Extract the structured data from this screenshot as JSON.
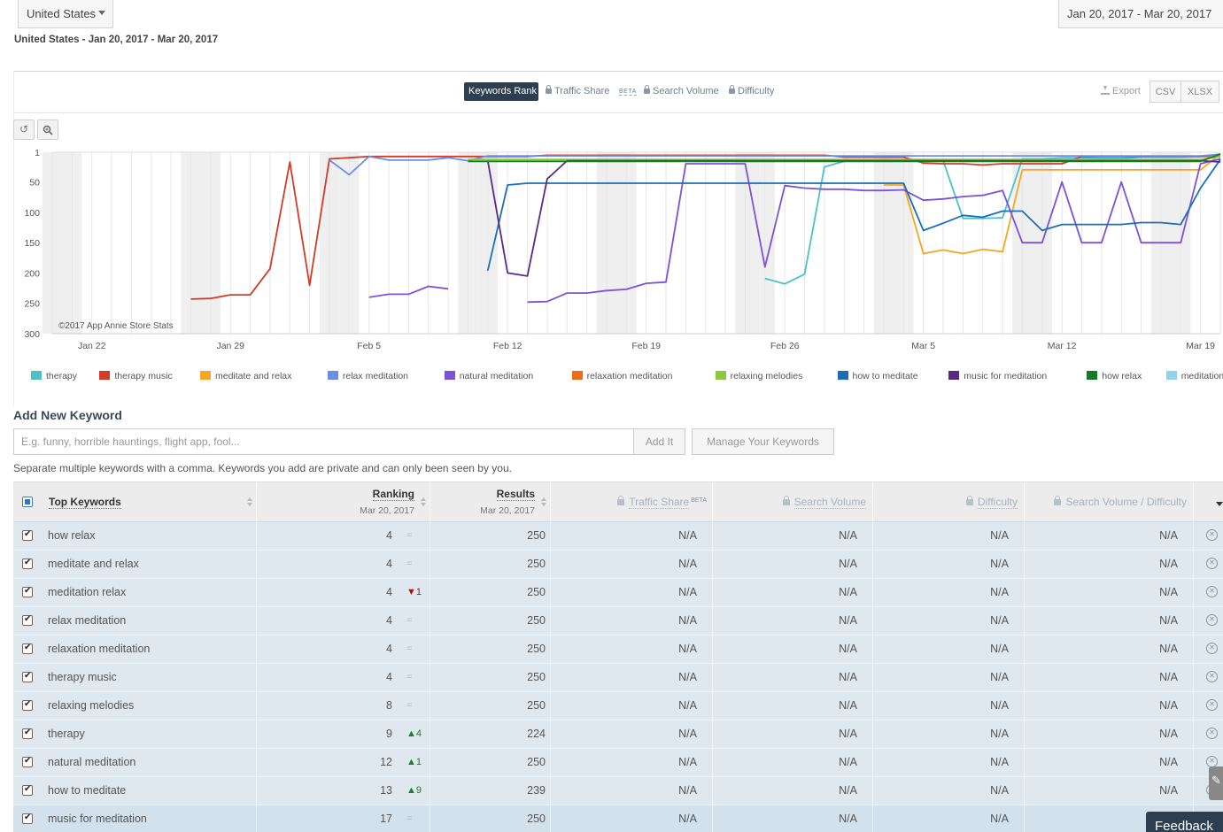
{
  "filters": {
    "country": "United States",
    "date_range": "Jan 20, 2017 - Mar 20, 2017",
    "summary": "United States - Jan 20, 2017 - Mar 20, 2017"
  },
  "tabs": {
    "active": "Keywords Rank",
    "traffic_share": "Traffic Share",
    "beta": "BETA",
    "search_volume": "Search Volume",
    "difficulty": "Difficulty"
  },
  "export": {
    "label": "Export",
    "csv": "CSV",
    "xlsx": "XLSX"
  },
  "zoom_controls": {
    "reset_icon": "undo-icon",
    "zoom_icon": "magnifier-icon"
  },
  "chart_data": {
    "type": "line",
    "credit": "©2017 App Annie Store Stats",
    "y_ticks": [
      "1",
      "50",
      "100",
      "150",
      "200",
      "250",
      "300"
    ],
    "ylim": [
      1,
      300
    ],
    "y_inverted": true,
    "x_ticks": [
      "Jan 22",
      "Jan 29",
      "Feb 5",
      "Feb 12",
      "Feb 19",
      "Feb 26",
      "Mar 5",
      "Mar 12",
      "Mar 19"
    ],
    "x": [
      "Jan 20",
      "Jan 21",
      "Jan 22",
      "Jan 23",
      "Jan 24",
      "Jan 25",
      "Jan 26",
      "Jan 27",
      "Jan 28",
      "Jan 29",
      "Jan 30",
      "Jan 31",
      "Feb 1",
      "Feb 2",
      "Feb 3",
      "Feb 4",
      "Feb 5",
      "Feb 6",
      "Feb 7",
      "Feb 8",
      "Feb 9",
      "Feb 10",
      "Feb 11",
      "Feb 12",
      "Feb 13",
      "Feb 14",
      "Feb 15",
      "Feb 16",
      "Feb 17",
      "Feb 18",
      "Feb 19",
      "Feb 20",
      "Feb 21",
      "Feb 22",
      "Feb 23",
      "Feb 24",
      "Feb 25",
      "Feb 26",
      "Feb 27",
      "Feb 28",
      "Mar 1",
      "Mar 2",
      "Mar 3",
      "Mar 4",
      "Mar 5",
      "Mar 6",
      "Mar 7",
      "Mar 8",
      "Mar 9",
      "Mar 10",
      "Mar 11",
      "Mar 12",
      "Mar 13",
      "Mar 14",
      "Mar 15",
      "Mar 16",
      "Mar 17",
      "Mar 18",
      "Mar 19",
      "Mar 20"
    ],
    "grid": true,
    "series": [
      {
        "name": "therapy",
        "color": "#4dc0c8",
        "values": [
          null,
          null,
          null,
          null,
          null,
          null,
          null,
          null,
          null,
          null,
          null,
          null,
          null,
          null,
          null,
          null,
          null,
          null,
          null,
          null,
          null,
          null,
          null,
          null,
          null,
          null,
          null,
          null,
          null,
          null,
          null,
          null,
          null,
          null,
          null,
          null,
          209,
          218,
          202,
          25,
          16,
          14,
          13,
          14,
          14,
          15,
          110,
          110,
          109,
          12,
          12,
          10,
          10,
          11,
          11,
          9,
          9,
          9,
          8,
          9
        ]
      },
      {
        "name": "therapy music",
        "color": "#d33b27",
        "values": [
          null,
          null,
          null,
          null,
          null,
          null,
          null,
          243,
          242,
          236,
          236,
          193,
          17,
          220,
          12,
          10,
          8,
          8,
          8,
          8,
          8,
          8,
          8,
          8,
          8,
          6,
          6,
          6,
          6,
          6,
          6,
          6,
          6,
          6,
          6,
          6,
          6,
          6,
          6,
          6,
          9,
          9,
          9,
          9,
          19,
          20,
          20,
          22,
          20,
          20,
          20,
          20,
          8,
          8,
          8,
          8,
          8,
          8,
          8,
          4
        ]
      },
      {
        "name": "meditate and relax",
        "color": "#f5a623",
        "values": [
          null,
          null,
          null,
          null,
          null,
          null,
          null,
          null,
          null,
          null,
          null,
          null,
          null,
          null,
          null,
          null,
          null,
          null,
          null,
          null,
          null,
          null,
          null,
          null,
          null,
          null,
          null,
          null,
          null,
          null,
          null,
          null,
          null,
          null,
          null,
          null,
          null,
          null,
          null,
          null,
          null,
          null,
          55,
          55,
          168,
          162,
          168,
          161,
          165,
          30,
          30,
          30,
          30,
          30,
          30,
          30,
          30,
          30,
          30,
          4
        ]
      },
      {
        "name": "relax meditation",
        "color": "#6b8fe8",
        "values": [
          null,
          null,
          null,
          null,
          null,
          null,
          null,
          null,
          null,
          null,
          null,
          null,
          null,
          null,
          14,
          38,
          8,
          14,
          14,
          14,
          10,
          15,
          7,
          7,
          7,
          7,
          7,
          7,
          7,
          7,
          7,
          7,
          7,
          7,
          7,
          7,
          7,
          7,
          7,
          7,
          7,
          7,
          7,
          7,
          7,
          7,
          7,
          7,
          7,
          7,
          7,
          7,
          7,
          7,
          7,
          7,
          7,
          7,
          7,
          4
        ]
      },
      {
        "name": "natural meditation",
        "color": "#7b52d8",
        "values": [
          null,
          null,
          null,
          null,
          null,
          null,
          null,
          null,
          null,
          null,
          null,
          null,
          null,
          null,
          null,
          null,
          240,
          235,
          235,
          222,
          226,
          null,
          null,
          null,
          248,
          247,
          233,
          233,
          229,
          227,
          217,
          215,
          20,
          20,
          20,
          20,
          190,
          56,
          60,
          62,
          62,
          64,
          64,
          63,
          80,
          78,
          74,
          72,
          64,
          150,
          150,
          50,
          150,
          150,
          50,
          150,
          150,
          150,
          20,
          12
        ]
      },
      {
        "name": "relaxation meditation",
        "color": "#ec6c17",
        "values": [
          null,
          null,
          null,
          null,
          null,
          null,
          null,
          null,
          null,
          null,
          null,
          null,
          null,
          null,
          null,
          null,
          null,
          null,
          null,
          null,
          null,
          null,
          null,
          null,
          null,
          null,
          null,
          null,
          null,
          null,
          null,
          null,
          null,
          null,
          null,
          null,
          null,
          null,
          null,
          null,
          null,
          null,
          null,
          null,
          null,
          null,
          null,
          null,
          null,
          null,
          null,
          null,
          null,
          null,
          null,
          null,
          null,
          null,
          null,
          null
        ]
      },
      {
        "name": "relaxing melodies",
        "color": "#8dc63f",
        "values": [
          null,
          null,
          null,
          null,
          null,
          null,
          null,
          null,
          null,
          null,
          null,
          null,
          null,
          null,
          null,
          null,
          null,
          null,
          null,
          null,
          null,
          13,
          13,
          13,
          13,
          13,
          13,
          13,
          13,
          13,
          13,
          13,
          13,
          13,
          13,
          13,
          13,
          13,
          13,
          13,
          13,
          13,
          13,
          13,
          13,
          13,
          13,
          13,
          13,
          13,
          13,
          13,
          13,
          13,
          13,
          13,
          13,
          13,
          13,
          8
        ]
      },
      {
        "name": "how to meditate",
        "color": "#1b6fb8",
        "values": [
          null,
          null,
          null,
          null,
          null,
          null,
          null,
          null,
          null,
          null,
          null,
          null,
          null,
          null,
          null,
          null,
          null,
          null,
          null,
          null,
          null,
          null,
          196,
          55,
          52,
          52,
          52,
          52,
          52,
          52,
          52,
          52,
          52,
          52,
          52,
          52,
          52,
          52,
          52,
          52,
          52,
          52,
          52,
          52,
          130,
          118,
          105,
          108,
          98,
          98,
          130,
          120,
          120,
          120,
          120,
          117,
          117,
          120,
          60,
          13
        ]
      },
      {
        "name": "music for meditation",
        "color": "#5a2a82",
        "values": [
          null,
          null,
          null,
          null,
          null,
          null,
          null,
          null,
          null,
          null,
          null,
          null,
          null,
          null,
          null,
          null,
          null,
          null,
          null,
          null,
          null,
          null,
          15,
          200,
          205,
          45,
          15,
          15,
          15,
          15,
          15,
          15,
          15,
          15,
          15,
          15,
          15,
          15,
          15,
          15,
          15,
          15,
          15,
          15,
          15,
          15,
          15,
          15,
          15,
          15,
          15,
          15,
          15,
          15,
          15,
          15,
          15,
          15,
          15,
          17
        ]
      },
      {
        "name": "how relax",
        "color": "#157a28",
        "values": [
          null,
          null,
          null,
          null,
          null,
          null,
          null,
          null,
          null,
          null,
          null,
          null,
          null,
          null,
          null,
          null,
          null,
          null,
          null,
          null,
          null,
          16,
          16,
          16,
          16,
          16,
          16,
          16,
          16,
          16,
          16,
          16,
          16,
          16,
          16,
          16,
          16,
          16,
          16,
          16,
          16,
          16,
          16,
          16,
          16,
          16,
          16,
          16,
          16,
          16,
          16,
          16,
          16,
          16,
          16,
          16,
          16,
          16,
          16,
          4
        ]
      },
      {
        "name": "meditation relax",
        "color": "#8fd3ec",
        "values": [
          null,
          null,
          null,
          null,
          null,
          null,
          null,
          null,
          null,
          null,
          null,
          null,
          null,
          null,
          null,
          null,
          null,
          null,
          null,
          null,
          null,
          null,
          null,
          null,
          null,
          null,
          null,
          null,
          null,
          null,
          null,
          null,
          null,
          null,
          null,
          null,
          null,
          null,
          null,
          null,
          null,
          null,
          null,
          null,
          null,
          null,
          null,
          null,
          null,
          null,
          null,
          null,
          null,
          null,
          null,
          null,
          null,
          null,
          null,
          4
        ]
      }
    ]
  },
  "add_keyword": {
    "title": "Add New Keyword",
    "placeholder": "E.g. funny, horrible hauntings, flight app, fool...",
    "add_label": "Add It",
    "manage_label": "Manage Your Keywords",
    "hint": "Separate multiple keywords with a comma. Keywords you add are private and can only been seen by you."
  },
  "table": {
    "headers": {
      "keyword": "Top Keywords",
      "ranking": "Ranking",
      "ranking_date": "Mar 20, 2017",
      "results": "Results",
      "results_date": "Mar 20, 2017",
      "traffic_share": "Traffic Share",
      "traffic_beta": "BETA",
      "search_volume": "Search Volume",
      "difficulty": "Difficulty",
      "sv_difficulty": "Search Volume / Difficulty"
    },
    "rows": [
      {
        "keyword": "how relax",
        "rank": "4",
        "change": "=",
        "dir": "eq",
        "results": "250",
        "traffic": "N/A",
        "volume": "N/A",
        "difficulty": "N/A",
        "ratio": "N/A"
      },
      {
        "keyword": "meditate and relax",
        "rank": "4",
        "change": "=",
        "dir": "eq",
        "results": "250",
        "traffic": "N/A",
        "volume": "N/A",
        "difficulty": "N/A",
        "ratio": "N/A"
      },
      {
        "keyword": "meditation relax",
        "rank": "4",
        "change": "▼1",
        "dir": "down",
        "results": "250",
        "traffic": "N/A",
        "volume": "N/A",
        "difficulty": "N/A",
        "ratio": "N/A"
      },
      {
        "keyword": "relax meditation",
        "rank": "4",
        "change": "=",
        "dir": "eq",
        "results": "250",
        "traffic": "N/A",
        "volume": "N/A",
        "difficulty": "N/A",
        "ratio": "N/A"
      },
      {
        "keyword": "relaxation meditation",
        "rank": "4",
        "change": "=",
        "dir": "eq",
        "results": "250",
        "traffic": "N/A",
        "volume": "N/A",
        "difficulty": "N/A",
        "ratio": "N/A"
      },
      {
        "keyword": "therapy music",
        "rank": "4",
        "change": "=",
        "dir": "eq",
        "results": "250",
        "traffic": "N/A",
        "volume": "N/A",
        "difficulty": "N/A",
        "ratio": "N/A"
      },
      {
        "keyword": "relaxing melodies",
        "rank": "8",
        "change": "=",
        "dir": "eq",
        "results": "250",
        "traffic": "N/A",
        "volume": "N/A",
        "difficulty": "N/A",
        "ratio": "N/A"
      },
      {
        "keyword": "therapy",
        "rank": "9",
        "change": "▲4",
        "dir": "up",
        "results": "224",
        "traffic": "N/A",
        "volume": "N/A",
        "difficulty": "N/A",
        "ratio": "N/A"
      },
      {
        "keyword": "natural meditation",
        "rank": "12",
        "change": "▲1",
        "dir": "up",
        "results": "250",
        "traffic": "N/A",
        "volume": "N/A",
        "difficulty": "N/A",
        "ratio": "N/A"
      },
      {
        "keyword": "how to meditate",
        "rank": "13",
        "change": "▲9",
        "dir": "up",
        "results": "239",
        "traffic": "N/A",
        "volume": "N/A",
        "difficulty": "N/A",
        "ratio": "N/A"
      },
      {
        "keyword": "music for meditation",
        "rank": "17",
        "change": "=",
        "dir": "eq",
        "results": "250",
        "traffic": "N/A",
        "volume": "N/A",
        "difficulty": "N/A",
        "ratio": "N/A"
      }
    ]
  },
  "feedback": "Feedback"
}
